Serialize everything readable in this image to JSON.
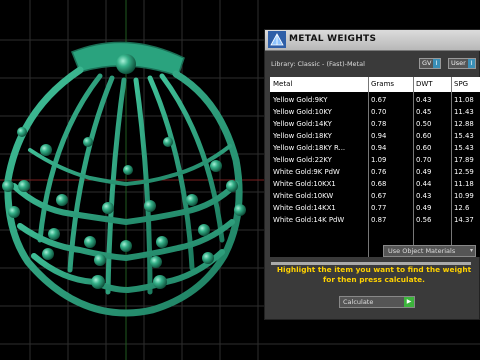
{
  "panel": {
    "title": "METAL WEIGHTS",
    "library_label": "Library: Classic - (Fast)-Metal",
    "toggle_gv": "GV",
    "toggle_user": "User",
    "toggle_knob": "I",
    "use_object_materials": "Use Object Materials",
    "message": "Highlight the item you want to find the weight for then press calculate.",
    "calculate_label": "Calculate",
    "go_glyph": "▶"
  },
  "table": {
    "columns": [
      "Metal",
      "Grams",
      "DWT",
      "SPG"
    ],
    "rows": [
      [
        "Yellow Gold:9KY",
        "0.67",
        "0.43",
        "11.08"
      ],
      [
        "Yellow Gold:10KY",
        "0.70",
        "0.45",
        "11.43"
      ],
      [
        "Yellow Gold:14KY",
        "0.78",
        "0.50",
        "12.88"
      ],
      [
        "Yellow Gold:18KY",
        "0.94",
        "0.60",
        "15.43"
      ],
      [
        "Yellow Gold:18KY R...",
        "0.94",
        "0.60",
        "15.43"
      ],
      [
        "Yellow Gold:22KY",
        "1.09",
        "0.70",
        "17.89"
      ],
      [
        "White Gold:9K PdW",
        "0.76",
        "0.49",
        "12.59"
      ],
      [
        "White Gold:10KX1",
        "0.68",
        "0.44",
        "11.18"
      ],
      [
        "White Gold:10KW",
        "0.67",
        "0.43",
        "10.99"
      ],
      [
        "White Gold:14KX1",
        "0.77",
        "0.49",
        "12.6"
      ],
      [
        "White Gold:14K PdW",
        "0.87",
        "0.56",
        "14.37"
      ]
    ]
  },
  "colors": {
    "jewel": "#2fa983",
    "accent": "#ffd200",
    "grid": "#2e2e2e"
  },
  "icons": {
    "app": "metal-weights-icon",
    "viewport": "shell-pendant-model"
  }
}
